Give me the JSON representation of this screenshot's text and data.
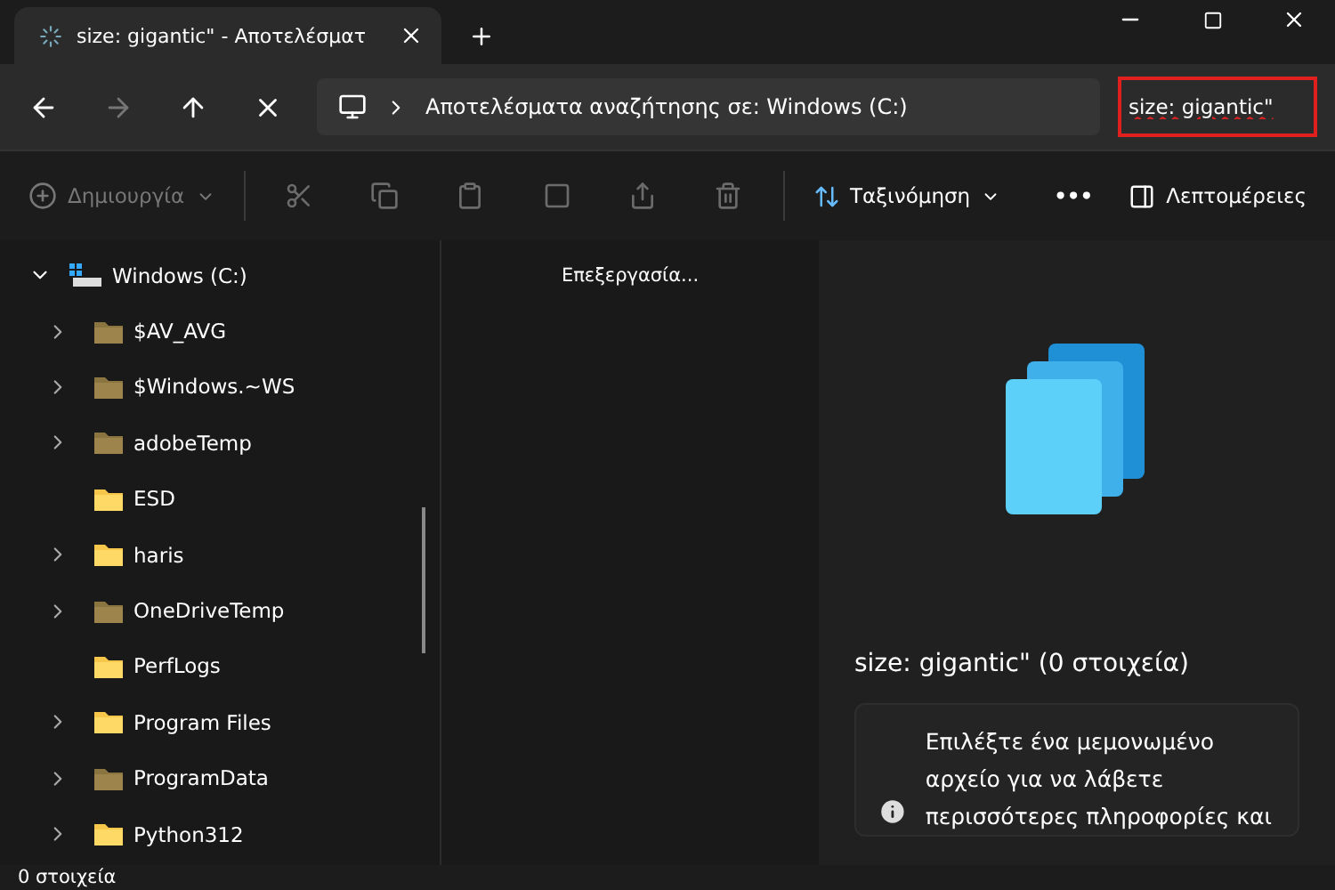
{
  "tab": {
    "title": "size: gigantic\" - Αποτελέσματ",
    "loading": true
  },
  "address": {
    "location": "Αποτελέσματα αναζήτησης σε: Windows (C:)",
    "search": "size: gigantic\""
  },
  "toolbar": {
    "new": "Δημιουργία",
    "sort": "Ταξινόμηση",
    "more": "•••",
    "details": "Λεπτομέρειες"
  },
  "tree": {
    "label": "Windows (C:)",
    "expanded": true,
    "children": [
      {
        "label": "$AV_AVG",
        "expandable": true,
        "hidden": true
      },
      {
        "label": "$Windows.~WS",
        "expandable": true,
        "hidden": true
      },
      {
        "label": "adobeTemp",
        "expandable": true,
        "hidden": true
      },
      {
        "label": "ESD",
        "expandable": false,
        "hidden": false
      },
      {
        "label": "haris",
        "expandable": true,
        "hidden": false
      },
      {
        "label": "OneDriveTemp",
        "expandable": true,
        "hidden": true
      },
      {
        "label": "PerfLogs",
        "expandable": false,
        "hidden": false
      },
      {
        "label": "Program Files",
        "expandable": true,
        "hidden": false
      },
      {
        "label": "ProgramData",
        "expandable": true,
        "hidden": true
      },
      {
        "label": "Python312",
        "expandable": true,
        "hidden": false
      }
    ]
  },
  "content": {
    "status": "Επεξεργασία..."
  },
  "details": {
    "title": "size: gigantic\" (0 στοιχεία)",
    "info": "Επιλέξτε ένα μεμονωμένο αρχείο για να λάβετε περισσότερες πληροφορίες και"
  },
  "status_bar": {
    "count": "0 στοιχεία"
  }
}
